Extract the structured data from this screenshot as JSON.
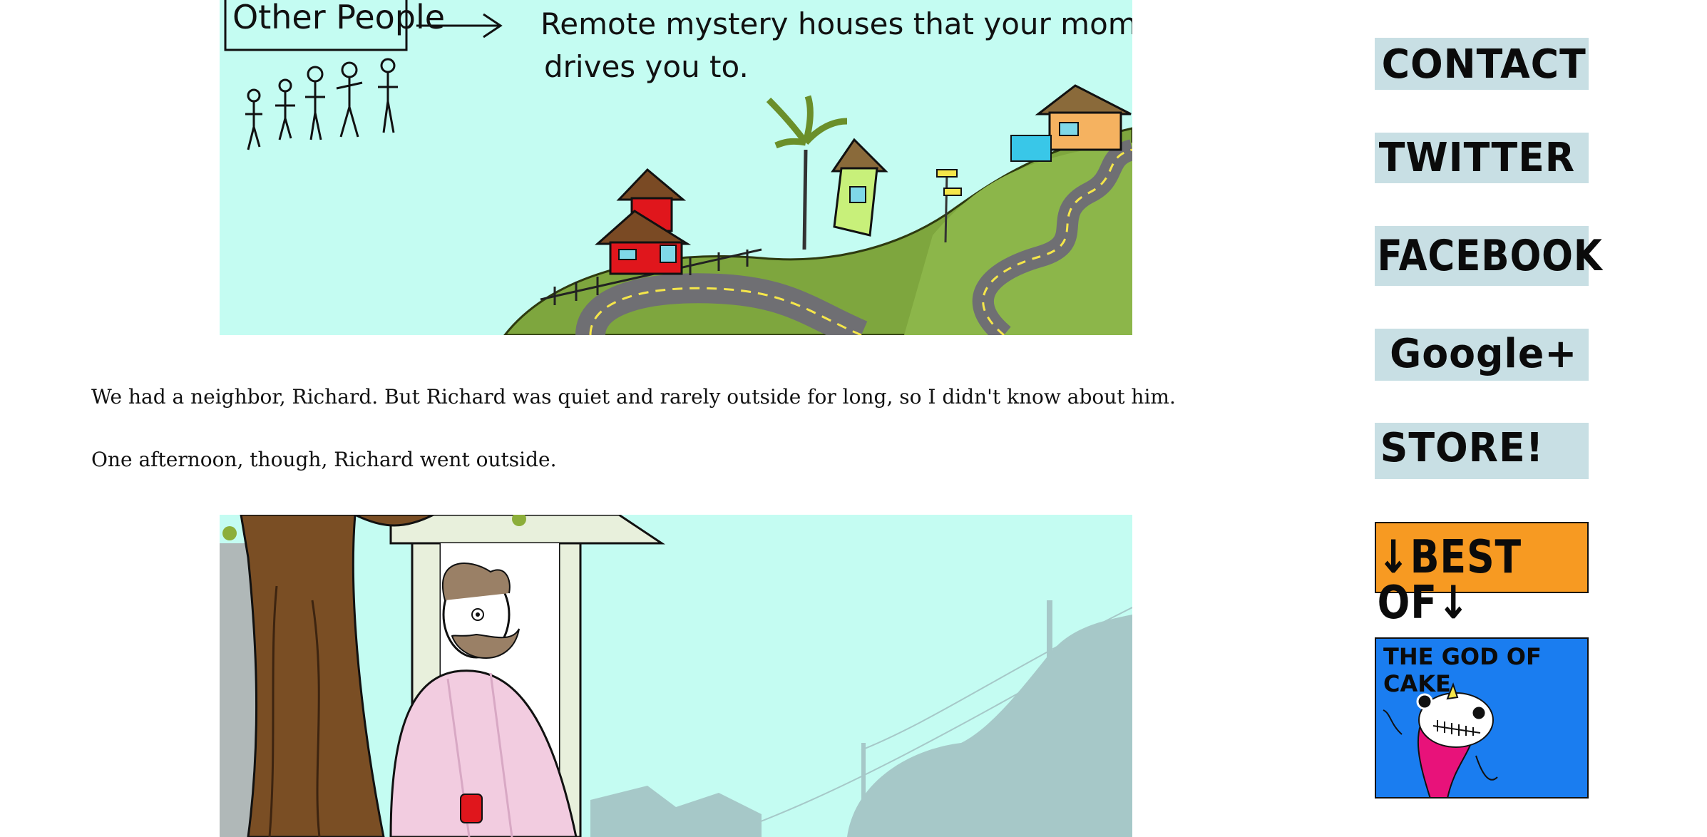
{
  "comic_top": {
    "label": "Other People",
    "caption_line1": "Remote mystery houses that your mom",
    "caption_line2": "drives you to."
  },
  "article": {
    "paragraph1": "We had a neighbor, Richard. But Richard was quiet and rarely outside for long, so I didn't know about him.",
    "paragraph2": "One afternoon, though, Richard went outside."
  },
  "sidebar": {
    "contact": "CONTACT",
    "twitter": "TWITTER",
    "facebook": "FACEBOOK",
    "google": "Google+",
    "store": "STORE!",
    "best_of": "↓BEST OF↓",
    "god_of_cake": "THE GOD OF CAKE"
  },
  "colors": {
    "sky": "#c4fcf2",
    "grass": "#7ea63e",
    "road": "#6f6f73",
    "button_bg": "#c8dfe4",
    "best_of_bg": "#f79a22",
    "god_of_cake_bg": "#1a7df0",
    "god_of_cake_figure": "#e8127a"
  }
}
